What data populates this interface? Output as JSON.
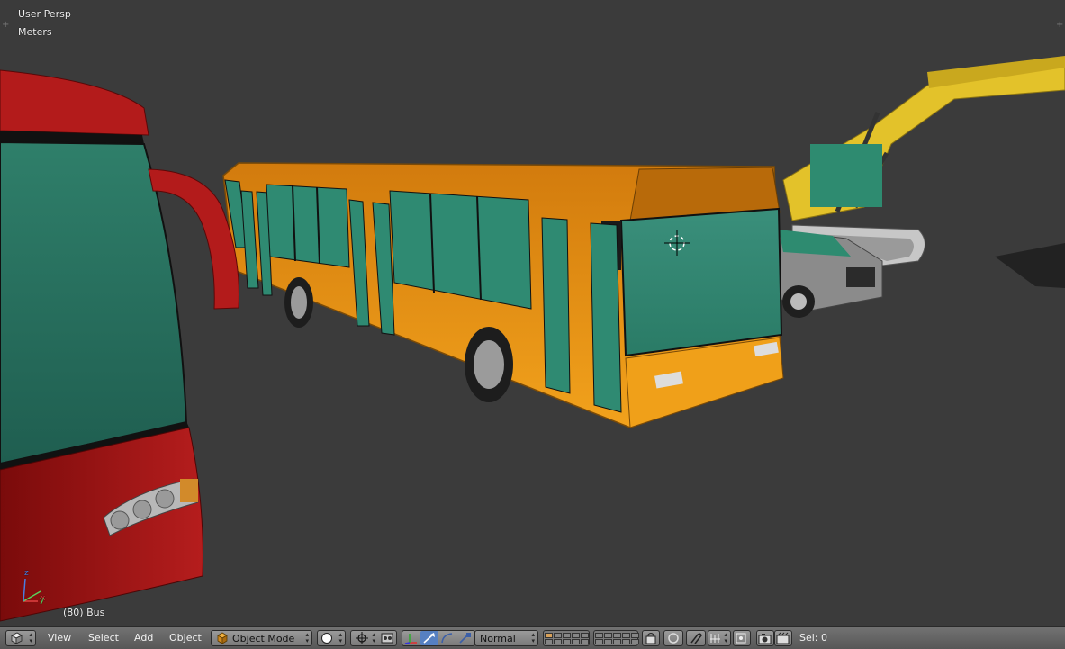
{
  "viewport": {
    "view_name": "User Persp",
    "units": "Meters",
    "object_info": "(80) Bus",
    "axes": {
      "x": "x",
      "y": "y",
      "z": "z"
    }
  },
  "header": {
    "editor_type_icon": "3d-view-icon",
    "menus": [
      "View",
      "Select",
      "Add",
      "Object"
    ],
    "mode": {
      "icon": "object-cube-icon",
      "label": "Object Mode"
    },
    "shading_icon": "solid-shading-icon",
    "pivot_icon": "pivot-point-icon",
    "manipulator_icons": [
      "manipulator-axes-icon",
      "translate-icon",
      "rotate-icon",
      "scale-icon"
    ],
    "orientation": "Normal",
    "layers_icons": [
      "layer-grid-icon"
    ],
    "snap_icons": [
      "lock-camera-icon",
      "proportional-edit-icon",
      "snap-icon",
      "snap-element-icon",
      "snap-target-icon"
    ],
    "render_icons": [
      "opengl-render-icon",
      "opengl-anim-icon"
    ],
    "selection_count": "Sel: 0"
  },
  "colors": {
    "bus_orange": "#e58a0f",
    "bus_window": "#2f8a72",
    "red_bus": "#a31414",
    "excavator": "#e3c22a",
    "background": "#3b3b3b"
  }
}
